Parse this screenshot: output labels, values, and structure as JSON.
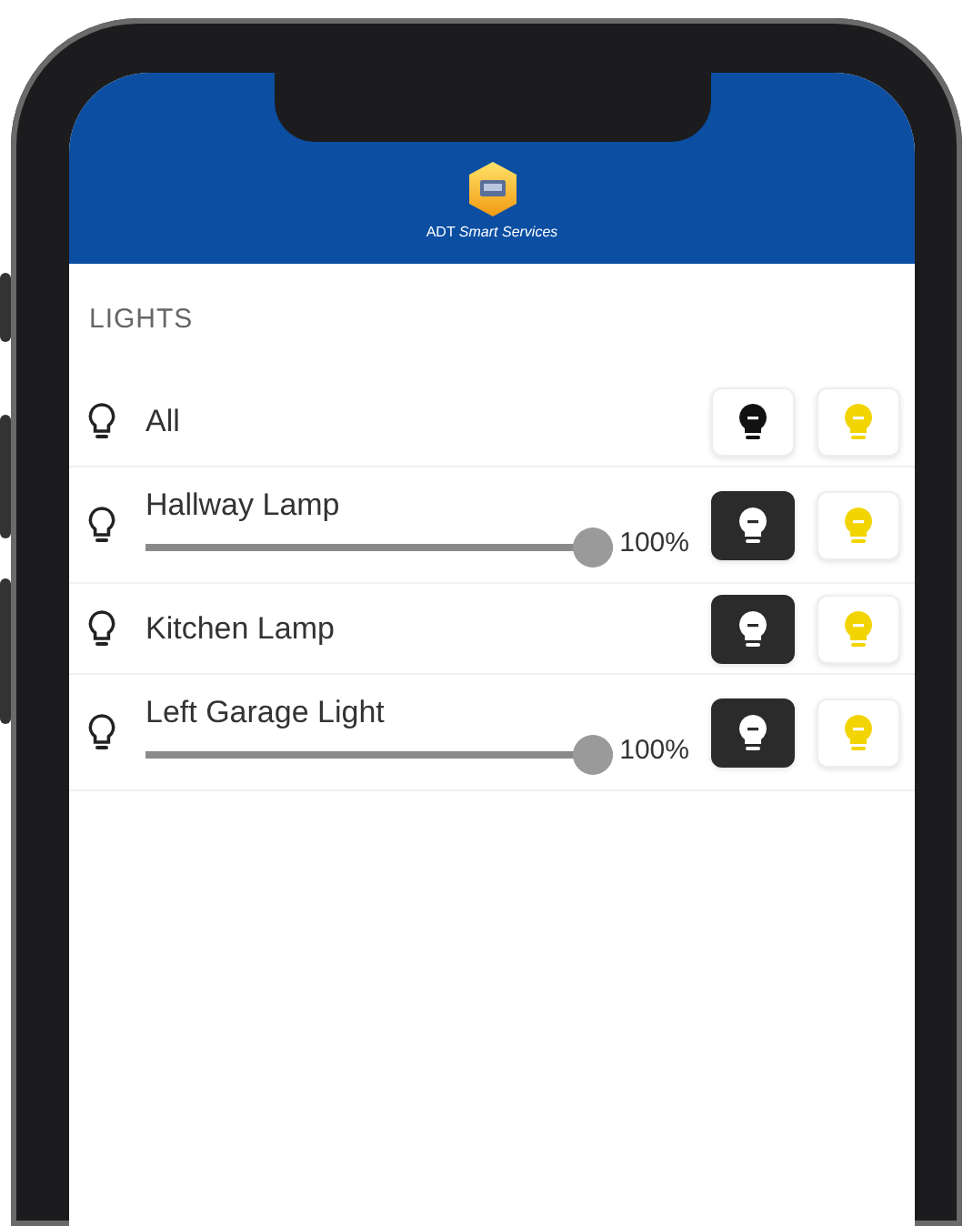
{
  "header": {
    "app_name": "ADT *Smart Services*"
  },
  "section": {
    "title": "LIGHTS"
  },
  "lights": [
    {
      "name": "All",
      "kind": "group",
      "buttons": [
        {
          "kind": "off",
          "selected": false
        },
        {
          "kind": "on",
          "selected": false
        }
      ]
    },
    {
      "name": "Hallway Lamp",
      "kind": "dimmer",
      "level": 1,
      "reading": "100%",
      "buttons": [
        {
          "kind": "off",
          "selected": true
        },
        {
          "kind": "on",
          "selected": false
        }
      ]
    },
    {
      "name": "Kitchen Lamp",
      "kind": "switch",
      "buttons": [
        {
          "kind": "off",
          "selected": true
        },
        {
          "kind": "on",
          "selected": false
        }
      ]
    },
    {
      "name": "Left Garage Light",
      "kind": "dimmer",
      "level": 1,
      "reading": "100%",
      "buttons": [
        {
          "kind": "off",
          "selected": true
        },
        {
          "kind": "on",
          "selected": false
        }
      ]
    }
  ]
}
